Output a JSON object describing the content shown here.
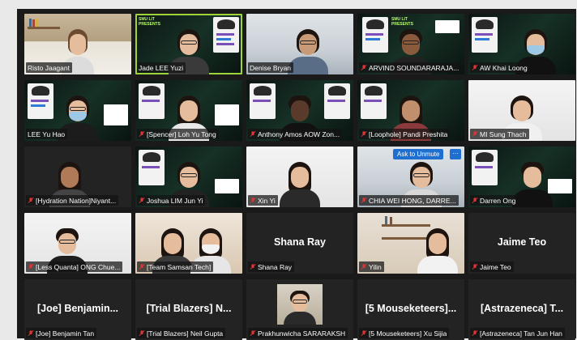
{
  "meeting": {
    "accent_speaking": "#9fd33a",
    "muted_icon_color": "#e03434",
    "ask_to_unmute": "Ask to Unmute",
    "more_options": "···",
    "poster_lines": [
      "SMU LIT",
      "PRESENTS",
      "HACKATHON 2021"
    ],
    "poster_sponsor": "Linklaters",
    "poster_sponsor_short": "SAL"
  },
  "participants": [
    {
      "name": "Risto Jaagant",
      "muted": false
    },
    {
      "name": "Jade LEE Yuzi",
      "muted": false,
      "speaking": true
    },
    {
      "name": "Denise Bryan",
      "muted": false
    },
    {
      "name": "ARVIND SOUNDARARAJA...",
      "muted": true
    },
    {
      "name": "AW Khai Loong",
      "muted": true
    },
    {
      "name": "LEE Yu Hao",
      "muted": false
    },
    {
      "name": "[Spencer] Loh Yu Tong",
      "muted": true
    },
    {
      "name": "Anthony Amos AOW Zon...",
      "muted": true
    },
    {
      "name": "[Loophole] Pandi Preshita",
      "muted": true
    },
    {
      "name": "MI Sung Thach",
      "muted": true
    },
    {
      "name": "[Hydration Nation]Niyant...",
      "muted": true
    },
    {
      "name": "Joshua LIM Jun Yi",
      "muted": true
    },
    {
      "name": "Xin Yi",
      "muted": true
    },
    {
      "name": "CHIA WEI HONG, DARRE...",
      "muted": true
    },
    {
      "name": "Darren Ong",
      "muted": true
    },
    {
      "name": "[Less Quanta] ONG Chue...",
      "muted": true
    },
    {
      "name": "[Team Samsan Tech]",
      "muted": true
    },
    {
      "name": "Shana Ray",
      "muted": true,
      "display_name": "Shana Ray"
    },
    {
      "name": "Yilin",
      "muted": true
    },
    {
      "name": "Jaime Teo",
      "muted": true,
      "display_name": "Jaime Teo"
    },
    {
      "name": "[Joe] Benjamin Tan",
      "muted": true,
      "display_name": "[Joe]  Benjamin..."
    },
    {
      "name": "[Trial Blazers] Neil Gupta",
      "muted": true,
      "display_name": "[Trial Blazers]  N..."
    },
    {
      "name": "Prakhunwicha SARARAKSH",
      "muted": true
    },
    {
      "name": "[5 Mouseketeers] Xu Sijia",
      "muted": true,
      "display_name": "[5  Mouseketeers]..."
    },
    {
      "name": "[Astrazeneca] Tan Jun Han",
      "muted": true,
      "display_name": "[Astrazeneca]  T..."
    }
  ]
}
